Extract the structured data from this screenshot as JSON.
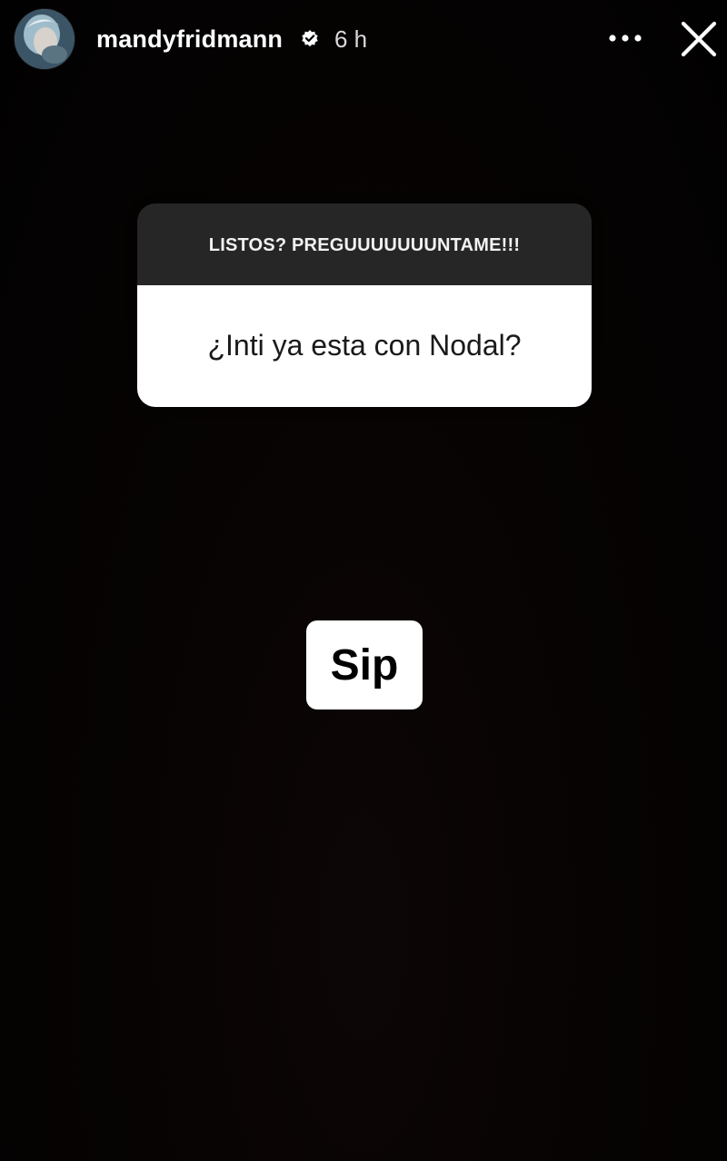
{
  "header": {
    "username": "mandyfridmann",
    "timestamp": "6 h",
    "verified": true,
    "icons": {
      "verified": "verified-badge-icon",
      "more": "more-dots-icon",
      "close": "close-icon"
    }
  },
  "question_sticker": {
    "prompt": "LISTOS? PREGUUUUUUUNTAME!!!",
    "question": "¿Inti ya esta con Nodal?"
  },
  "answer": {
    "text": "Sip"
  },
  "colors": {
    "background": "#000000",
    "sticker_header": "#262626",
    "sticker_body": "#ffffff",
    "text_light": "#ffffff",
    "text_dark": "#1a1a1a"
  }
}
